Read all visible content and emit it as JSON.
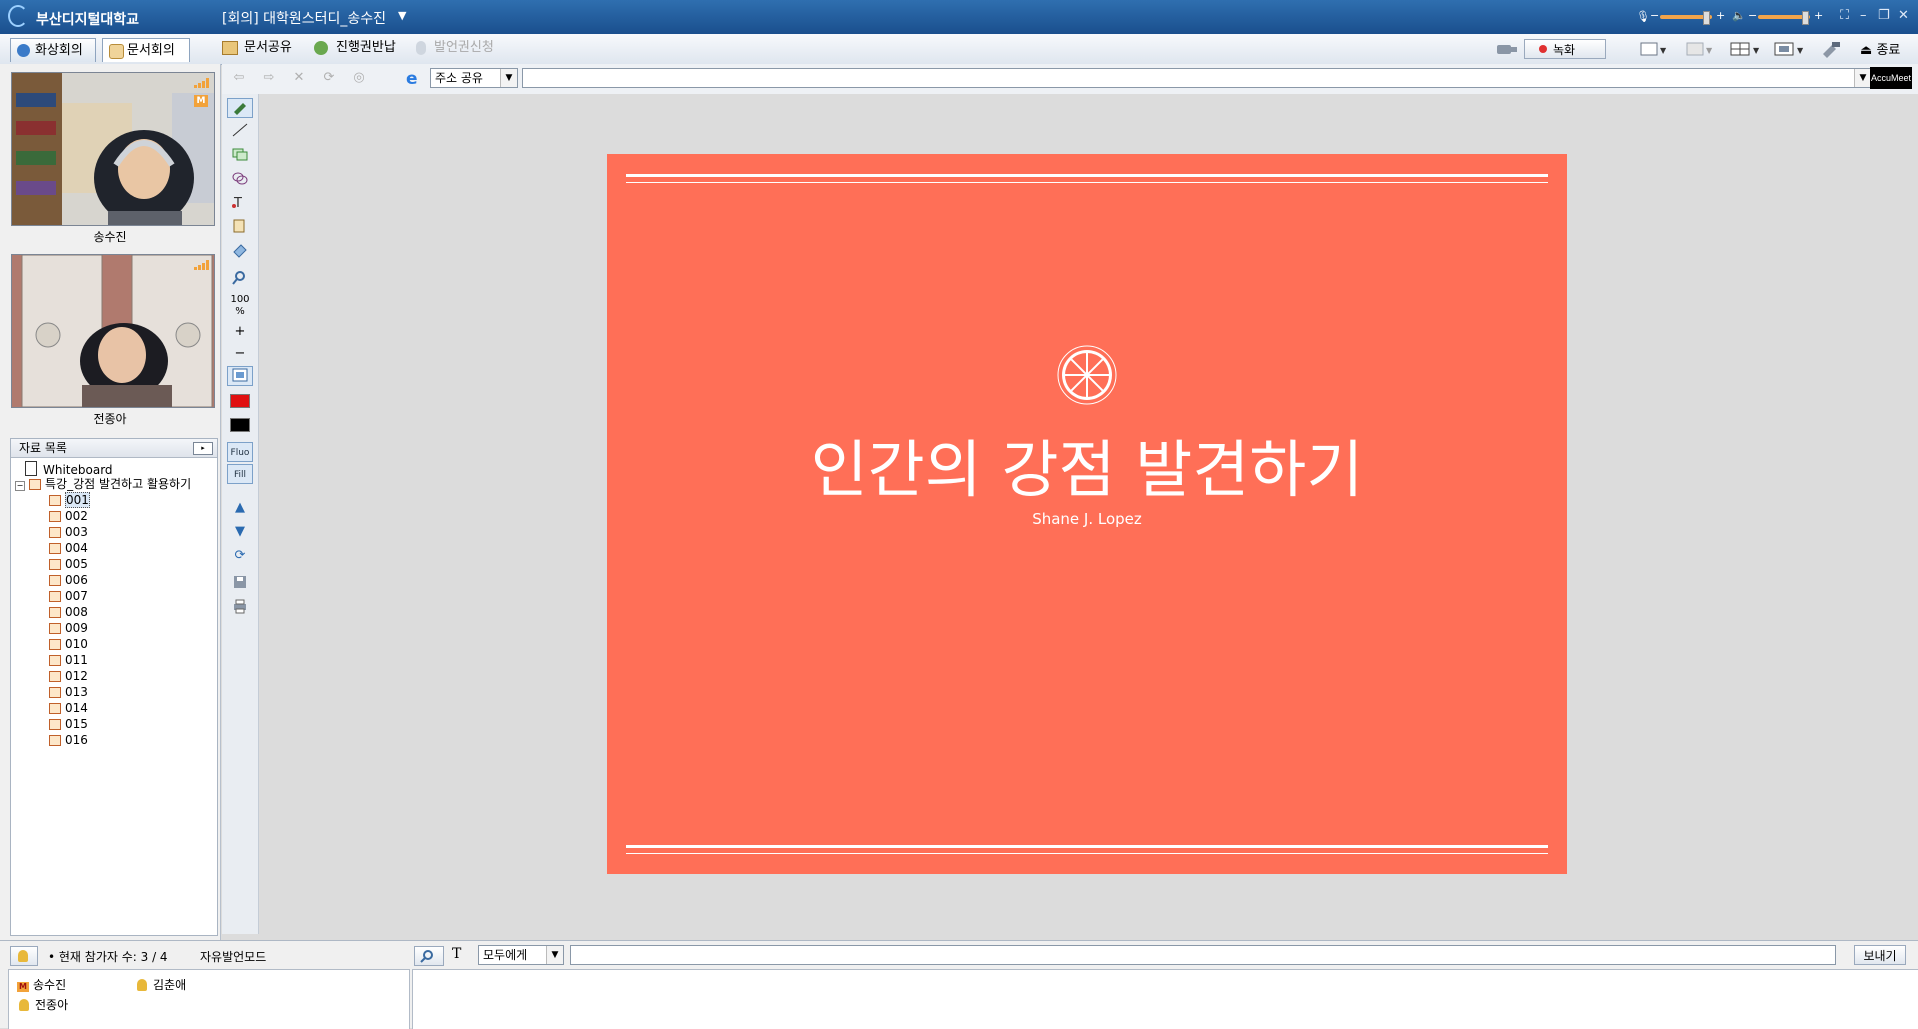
{
  "titlebar": {
    "university": "부산디지털대학교",
    "meeting_title": "[회의] 대학원스터디_송수진",
    "dropdown_glyph": "▼",
    "window_buttons": [
      "⛶",
      "–",
      "❐",
      "✕"
    ]
  },
  "tabs": [
    {
      "label": "화상회의",
      "active": false
    },
    {
      "label": "문서회의",
      "active": true
    }
  ],
  "toolbar": {
    "doc_share": "문서공유",
    "return_control": "진행권반납",
    "request_speak": "발언권신청",
    "record": "녹화",
    "exit": "종료"
  },
  "address_bar": {
    "mode": "주소 공유",
    "url": "",
    "brand": "AccuMeet"
  },
  "participants_video": [
    {
      "name": "송수진",
      "badge": "M"
    },
    {
      "name": "전종아",
      "badge": ""
    }
  ],
  "file_list": {
    "header": "자료 목록",
    "root_whiteboard": "Whiteboard",
    "document": "특강_강점 발견하고 활용하기",
    "pages": [
      "001",
      "002",
      "003",
      "004",
      "005",
      "006",
      "007",
      "008",
      "009",
      "010",
      "011",
      "012",
      "013",
      "014",
      "015",
      "016"
    ],
    "selected": "001"
  },
  "tools": {
    "zoom": "100",
    "zoom_unit": "%",
    "plus": "+",
    "minus": "−",
    "fluo": "Fluo",
    "fill": "Fill"
  },
  "colors": {
    "slide_bg": "#ff6f57",
    "pen_color": "#e01010",
    "fill_color": "#000000",
    "accent": "#1a4f8e"
  },
  "slide": {
    "title": "인간의 강점 발견하기",
    "author": "Shane J. Lopez"
  },
  "bottom": {
    "participant_count": "• 현재 참가자 수: 3 / 4",
    "mode": "자유발언모드",
    "participants": [
      {
        "name": "송수진",
        "role": "M"
      },
      {
        "name": "김춘애",
        "role": "user"
      },
      {
        "name": "전종아",
        "role": "user"
      }
    ],
    "chat_target": "모두에게",
    "chat_input": "",
    "send": "보내기"
  }
}
